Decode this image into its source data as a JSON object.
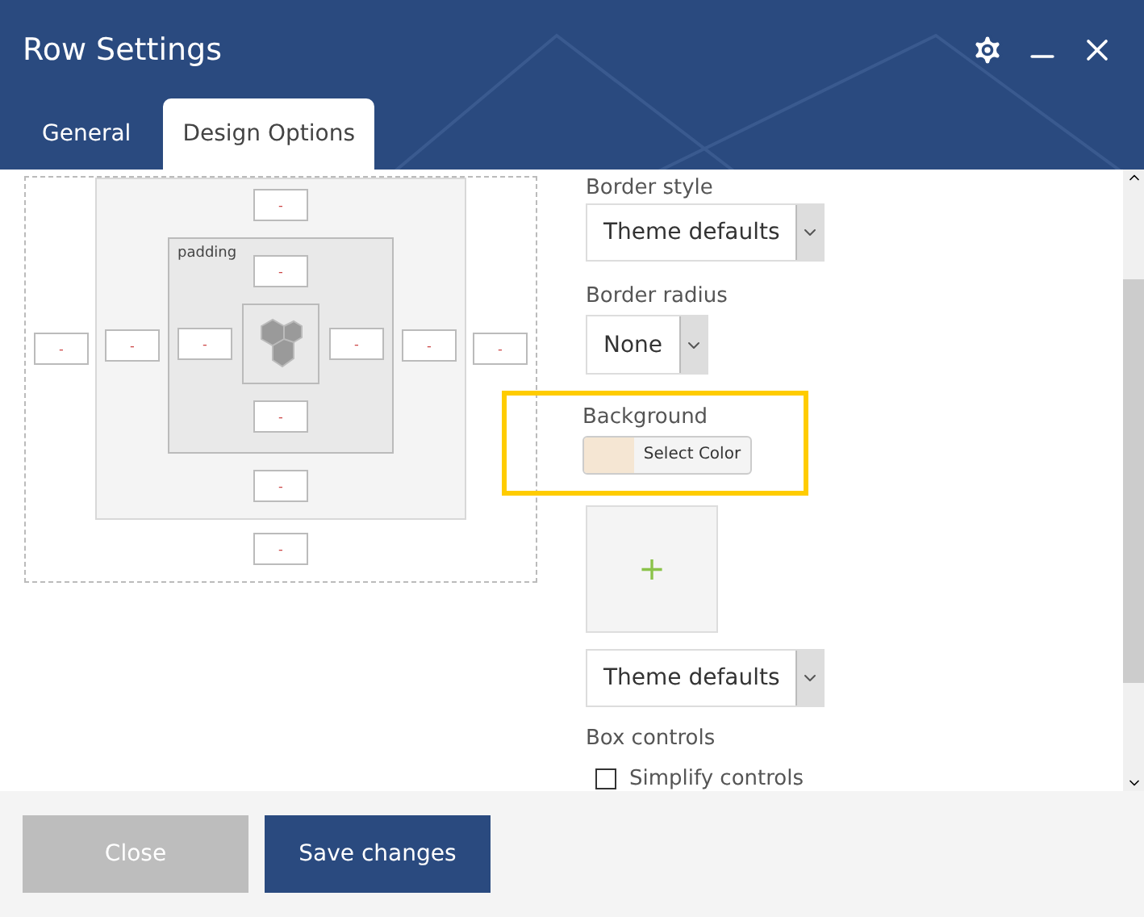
{
  "window": {
    "title": "Row Settings"
  },
  "tabs": [
    {
      "label": "General",
      "selected": false
    },
    {
      "label": "Design Options",
      "selected": true
    }
  ],
  "box_model": {
    "margin": {
      "left": "-",
      "right": "-",
      "bottom": "-"
    },
    "border": {
      "top": "-",
      "left": "-",
      "right": "-",
      "bottom": "-"
    },
    "padding": {
      "label": "padding",
      "top": "-",
      "left": "-",
      "right": "-",
      "bottom": "-"
    }
  },
  "options": {
    "border_style": {
      "label": "Border style",
      "value": "Theme defaults"
    },
    "border_radius": {
      "label": "Border radius",
      "value": "None"
    },
    "background": {
      "label": "Background",
      "button": "Select Color",
      "color": "#f5e6d3",
      "highlighted": true
    },
    "image_add": {
      "symbol": "+"
    },
    "background_style": {
      "value": "Theme defaults"
    },
    "box_controls": {
      "label": "Box controls",
      "checkbox": {
        "label": "Simplify controls",
        "checked": false
      }
    }
  },
  "buttons": [
    {
      "label": "Close",
      "disabled": true
    },
    {
      "label": "Save changes",
      "disabled": false
    }
  ]
}
